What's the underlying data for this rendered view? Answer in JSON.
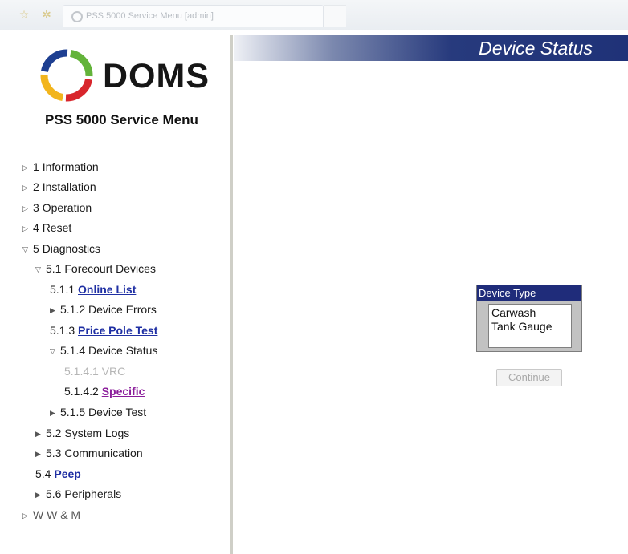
{
  "browser": {
    "tab_title": "PSS 5000 Service Menu [admin]",
    "icons": [
      "star-icon",
      "gear-icon",
      "loading-icon"
    ]
  },
  "sidebar": {
    "logo_text": "DOMS",
    "title": "PSS 5000 Service Menu",
    "items": [
      {
        "num": "1",
        "label": "Information",
        "state": "collapsed"
      },
      {
        "num": "2",
        "label": "Installation",
        "state": "collapsed"
      },
      {
        "num": "3",
        "label": "Operation",
        "state": "collapsed"
      },
      {
        "num": "4",
        "label": "Reset",
        "state": "collapsed"
      },
      {
        "num": "5",
        "label": "Diagnostics",
        "state": "expanded"
      },
      {
        "num": "5.1",
        "label": "Forecourt Devices",
        "state": "expanded"
      },
      {
        "num": "5.1.1",
        "label": "Online List",
        "state": "link"
      },
      {
        "num": "5.1.2",
        "label": "Device Errors",
        "state": "collapsed"
      },
      {
        "num": "5.1.3",
        "label": "Price Pole Test",
        "state": "link"
      },
      {
        "num": "5.1.4",
        "label": "Device Status",
        "state": "expanded"
      },
      {
        "num": "5.1.4.1",
        "label": "VRC",
        "state": "disabled"
      },
      {
        "num": "5.1.4.2",
        "label": "Specific",
        "state": "link-visited"
      },
      {
        "num": "5.1.5",
        "label": "Device Test",
        "state": "collapsed"
      },
      {
        "num": "5.2",
        "label": "System Logs",
        "state": "collapsed"
      },
      {
        "num": "5.3",
        "label": "Communication",
        "state": "collapsed"
      },
      {
        "num": "5.4",
        "label": "Peep",
        "state": "link"
      },
      {
        "num": "5.6",
        "label": "Peripherals",
        "state": "collapsed"
      },
      {
        "num": "",
        "label": "W W & M",
        "state": "collapsed"
      }
    ]
  },
  "main": {
    "header_title": "Device Status",
    "device_type": {
      "label": "Device Type",
      "options": [
        "Carwash",
        "Tank Gauge"
      ]
    },
    "continue_label": "Continue"
  },
  "colors": {
    "banner": "#1f3278",
    "link": "#1f2fa3",
    "visited_link": "#8a1c9a",
    "group_header": "#1f2c7a"
  }
}
